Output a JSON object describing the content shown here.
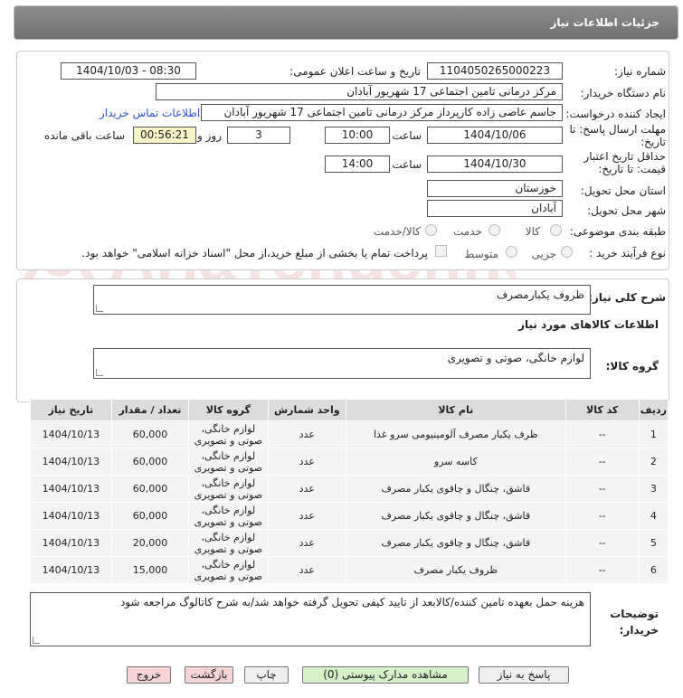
{
  "window": {
    "title": "جزئیات اطلاعات نیاز"
  },
  "watermark": {
    "text": "AriaTender.net"
  },
  "form": {
    "need_number": {
      "label": "شماره نیاز:",
      "value": "1104050265000223"
    },
    "announce_datetime": {
      "label": "تاریخ و ساعت اعلان عمومی:",
      "value": "1404/10/03 - 08:30"
    },
    "buyer_org": {
      "label": "نام دستگاه خریدار:",
      "value": "مرکز درمانی تامین اجتماعی 17 شهریور آبادان"
    },
    "requester": {
      "label": "ایجاد کننده درخواست:",
      "value": "جاسم عاصی زاده کارپرداز مرکز درمانی تامین اجتماعی 17 شهریور آبادان"
    },
    "contact_link": "اطلاعات تماس خریدار",
    "reply_deadline": {
      "label": "مهلت ارسال پاسخ: تا تاریخ:",
      "date": "1404/10/06",
      "time_label": "ساعت",
      "time": "10:00",
      "days": "3",
      "days_label": "روز و",
      "remaining": "00:56:21",
      "remaining_label": "ساعت باقی مانده"
    },
    "price_validity": {
      "label": "حداقل تاریخ اعتبار قیمت: تا تاریخ:",
      "date": "1404/10/30",
      "time_label": "ساعت",
      "time": "14:00"
    },
    "province": {
      "label": "استان محل تحویل:",
      "value": "خوزستان"
    },
    "city": {
      "label": "شهر محل تحویل:",
      "value": "آبادان"
    },
    "category": {
      "label": "طبقه بندی موضوعی:",
      "options": [
        "کالا",
        "خدمت",
        "کالا/خدمت"
      ]
    },
    "process_type": {
      "label": "نوع فرآیند خرید :",
      "options": [
        "جزیی",
        "متوسط"
      ],
      "payment_note": "پرداخت تمام یا بخشی از مبلغ خرید،از محل \"اسناد خزانه اسلامی\" خواهد بود."
    }
  },
  "summary": {
    "label": "شرح کلی نیاز:",
    "value": "ظروف یکبارمصرف"
  },
  "goods_section": {
    "title": "اطلاعات کالاهای مورد نیاز"
  },
  "goods_group": {
    "label": "گروه کالا:",
    "value": "لوازم خانگی، صوتی و تصویری"
  },
  "table": {
    "headers": [
      "ردیف",
      "کد کالا",
      "نام کالا",
      "واحد شمارش",
      "گروه کالا",
      "تعداد / مقدار",
      "تاریخ نیاز"
    ],
    "rows": [
      {
        "row": "1",
        "code": "--",
        "name": "ظرف یکبار مصرف آلومینیومی سرو غذا",
        "unit": "عدد",
        "group": "لوازم خانگی، صوتی و تصویری",
        "qty": "60,000",
        "date": "1404/10/13"
      },
      {
        "row": "2",
        "code": "--",
        "name": "کاسه سرو",
        "unit": "عدد",
        "group": "لوازم خانگی، صوتی و تصویری",
        "qty": "60,000",
        "date": "1404/10/13"
      },
      {
        "row": "3",
        "code": "--",
        "name": "قاشق، چنگال و چاقوی یکبار مصرف",
        "unit": "عدد",
        "group": "لوازم خانگی، صوتی و تصویری",
        "qty": "60,000",
        "date": "1404/10/13"
      },
      {
        "row": "4",
        "code": "--",
        "name": "قاشق، چنگال و چاقوی یکبار مصرف",
        "unit": "عدد",
        "group": "لوازم خانگی، صوتی و تصویری",
        "qty": "60,000",
        "date": "1404/10/13"
      },
      {
        "row": "5",
        "code": "--",
        "name": "قاشق، چنگال و چاقوی یکبار مصرف",
        "unit": "عدد",
        "group": "لوازم خانگی، صوتی و تصویری",
        "qty": "20,000",
        "date": "1404/10/13"
      },
      {
        "row": "6",
        "code": "--",
        "name": "ظروف یکبار مصرف",
        "unit": "عدد",
        "group": "لوازم خانگی، صوتی و تصویری",
        "qty": "15,000",
        "date": "1404/10/13"
      }
    ]
  },
  "buyer_notes": {
    "label": "توضیحات خریدار:",
    "value": "هزینه حمل بعهده تامین کننده/کالابعد از تایید کیفی تحویل گرفته خواهد شد/به شرح کاتالوگ مراجعه شود"
  },
  "buttons": {
    "reply": "پاسخ به نیاز",
    "attachments": "مشاهده مدارک پیوستی (0)",
    "print": "چاپ",
    "back": "بازگشت",
    "exit": "خروج"
  }
}
